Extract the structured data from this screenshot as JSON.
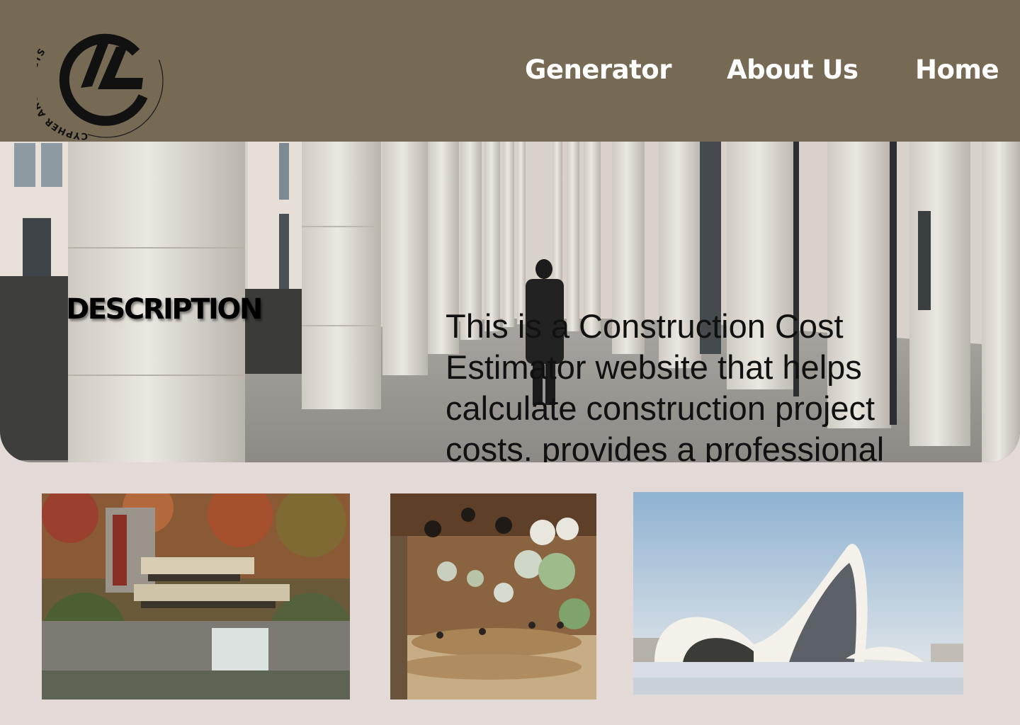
{
  "brand": {
    "logo_text": "CYPHER ARCHITECTS",
    "colors": {
      "header": "#776a55",
      "page_background": "#e3dad8",
      "nav_text": "#ffffff"
    }
  },
  "nav": {
    "items": [
      {
        "label": "Generator"
      },
      {
        "label": "About Us"
      },
      {
        "label": "Home"
      }
    ]
  },
  "hero": {
    "heading": "DESCRIPTION",
    "description": "This is a Construction Cost Estimator website that helps calculate construction project costs. provides a professional and user-friendly interface for construction",
    "image": "colonnade-walkway-photo"
  },
  "gallery": {
    "images": [
      {
        "name": "fallingwater-house-photo"
      },
      {
        "name": "organic-interior-photo"
      },
      {
        "name": "curved-white-building-photo"
      }
    ]
  }
}
